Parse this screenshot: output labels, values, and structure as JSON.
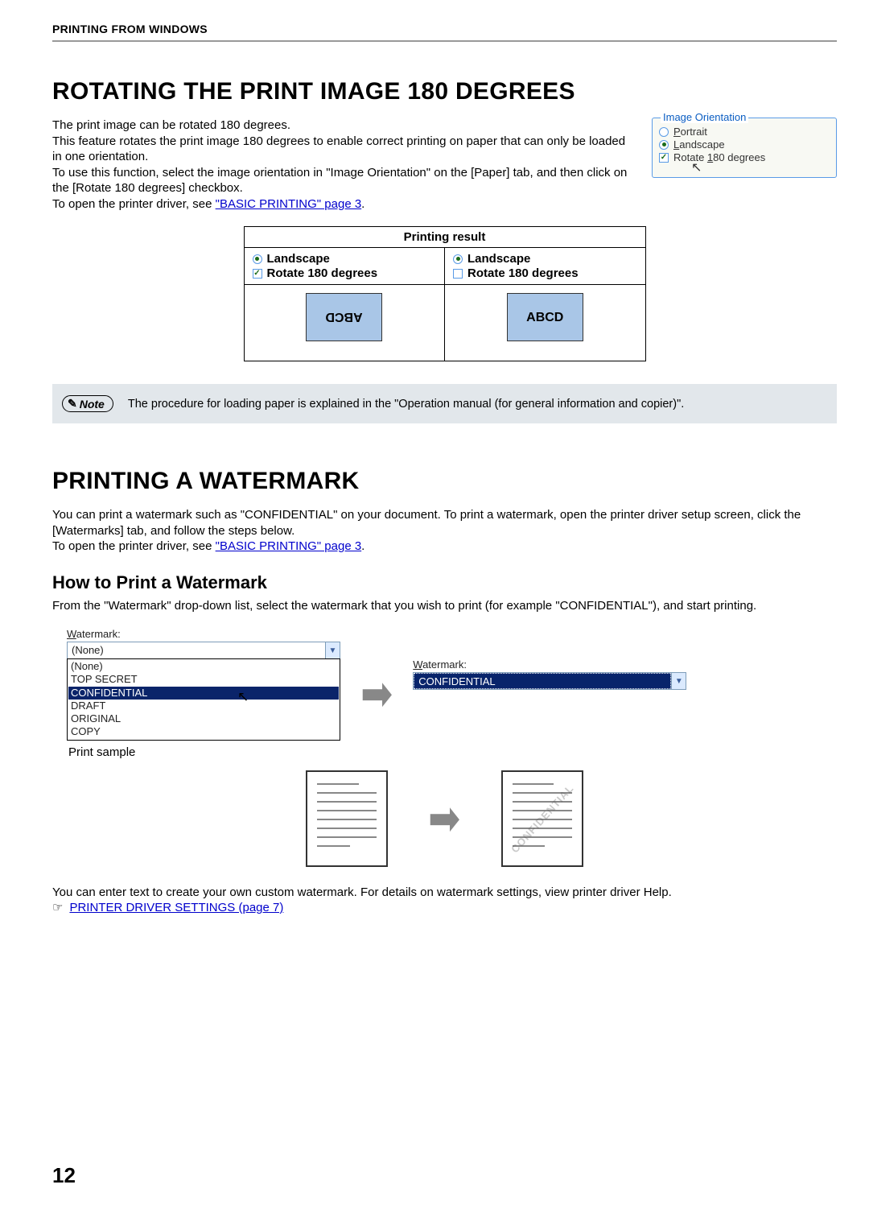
{
  "header": "PRINTING FROM WINDOWS",
  "section1": {
    "title": "ROTATING THE PRINT IMAGE 180 DEGREES",
    "p1": "The print image can be rotated 180 degrees.",
    "p2": "This feature rotates the print image 180 degrees to enable correct printing on paper that can only be loaded in one orientation.",
    "p3": "To use this function, select the image orientation in \"Image Orientation\" on the [Paper] tab, and then click on the [Rotate 180 degrees] checkbox.",
    "p4_pre": "To open the printer driver, see ",
    "link1": "\"BASIC PRINTING\" page 3",
    "p4_post": ".",
    "orientation": {
      "legend": "Image Orientation",
      "portrait": "Portrait",
      "landscape": "Landscape",
      "rotate": "Rotate 180 degrees"
    },
    "table": {
      "header": "Printing result",
      "landscape": "Landscape",
      "rotate": "Rotate 180 degrees",
      "abcd": "ABCD",
      "abcd2": "ABCD"
    },
    "note_label": "Note",
    "note_text": "The procedure for loading paper is explained in the \"Operation manual (for general information and copier)\"."
  },
  "section2": {
    "title": "PRINTING A WATERMARK",
    "p1": "You can print a watermark such as \"CONFIDENTIAL\" on your document. To print a watermark, open the printer driver setup screen, click the [Watermarks] tab, and follow the steps below.",
    "p2_pre": "To open the printer driver, see ",
    "link2": "\"BASIC PRINTING\" page 3",
    "p2_post": ".",
    "subhead": "How to Print a Watermark",
    "sub_p": "From the \"Watermark\" drop-down list, select the watermark that you wish to print (for example \"CONFIDENTIAL\"), and start printing.",
    "wm_label": "Watermark:",
    "combo_value": "(None)",
    "options": {
      "o1": "(None)",
      "o2": "TOP SECRET",
      "o3": "CONFIDENTIAL",
      "o4": "DRAFT",
      "o5": "ORIGINAL",
      "o6": "COPY"
    },
    "selected_value": "CONFIDENTIAL",
    "print_sample": "Print sample",
    "watermark_overlay": "CONFIDENTIAL",
    "p3": "You can enter text to create your own custom watermark. For details on watermark settings, view printer driver Help.",
    "link3": "PRINTER DRIVER SETTINGS (page 7)",
    "pointer": "☞"
  },
  "page_number": "12"
}
